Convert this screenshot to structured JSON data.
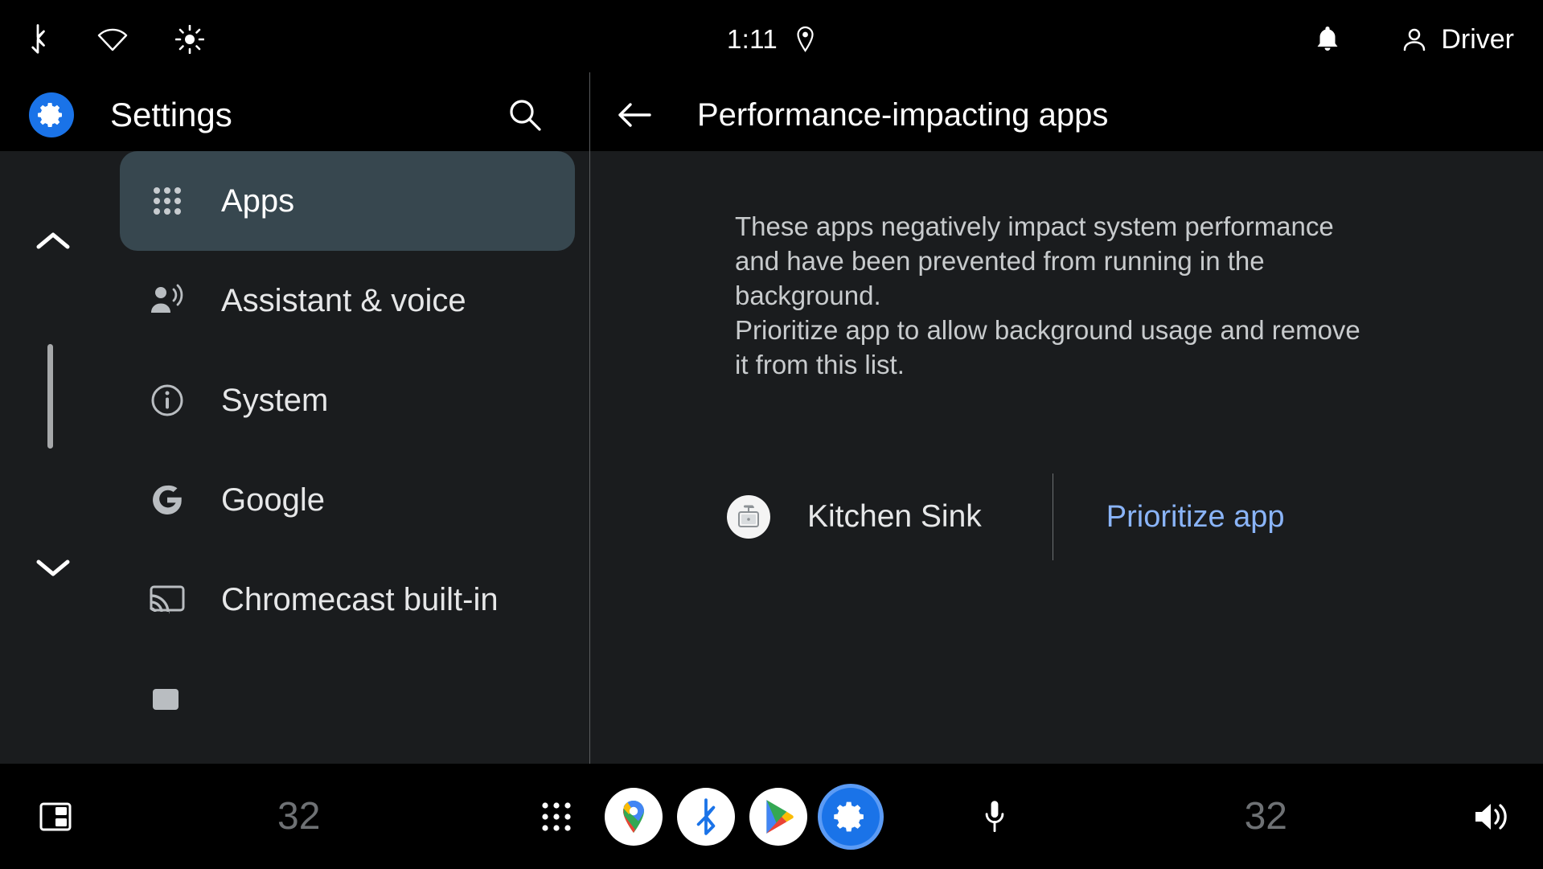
{
  "status_bar": {
    "icons_left": [
      "bluetooth-icon",
      "wifi-icon",
      "brightness-icon"
    ],
    "time": "1:11",
    "location_icon": "location-pin-icon",
    "notification_icon": "bell-icon",
    "profile_icon": "person-icon",
    "profile_label": "Driver"
  },
  "sidebar": {
    "app_icon": "settings-gear-icon",
    "title": "Settings",
    "search_icon": "search-icon",
    "scroll_up_icon": "chevron-up-icon",
    "scroll_down_icon": "chevron-down-icon",
    "items": [
      {
        "label": "Apps",
        "icon": "apps-grid-icon",
        "selected": true
      },
      {
        "label": "Assistant & voice",
        "icon": "assistant-voice-icon",
        "selected": false
      },
      {
        "label": "System",
        "icon": "info-circle-icon",
        "selected": false
      },
      {
        "label": "Google",
        "icon": "google-g-icon",
        "selected": false
      },
      {
        "label": "Chromecast built-in",
        "icon": "cast-icon",
        "selected": false
      }
    ]
  },
  "detail": {
    "back_icon": "back-arrow-icon",
    "title": "Performance-impacting apps",
    "description": "These apps negatively impact system performance and have been prevented from running in the background.\nPrioritize app to allow background usage and remove it from this list.",
    "app_row": {
      "icon": "kitchen-sink-app-icon",
      "name": "Kitchen Sink",
      "action_label": "Prioritize app"
    }
  },
  "navbar": {
    "panel_icon": "split-screen-icon",
    "temperature_left": "32",
    "grid_icon": "app-grid-icon",
    "apps": [
      {
        "name": "maps-icon",
        "active": false
      },
      {
        "name": "bluetooth-icon",
        "active": false
      },
      {
        "name": "play-store-icon",
        "active": false
      },
      {
        "name": "settings-icon",
        "active": true
      }
    ],
    "mic_icon": "microphone-icon",
    "temperature_right": "32",
    "volume_icon": "volume-icon"
  },
  "colors": {
    "accent_blue": "#1a73e8",
    "link_blue": "#8ab4f8",
    "selected_item_bg": "#37474f",
    "pane_bg": "#1a1c1e",
    "header_bg": "#000000"
  }
}
